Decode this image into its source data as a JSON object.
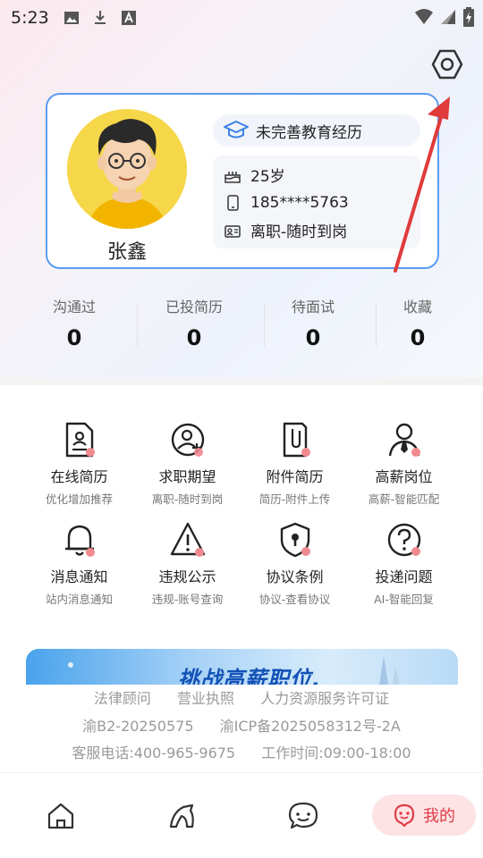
{
  "status_bar": {
    "time": "5:23"
  },
  "profile": {
    "name": "张鑫",
    "education": "未完善教育经历",
    "age": "25岁",
    "phone": "185****5763",
    "job_status": "离职-随时到岗"
  },
  "stats": [
    {
      "label": "沟通过",
      "value": "0"
    },
    {
      "label": "已投简历",
      "value": "0"
    },
    {
      "label": "待面试",
      "value": "0"
    },
    {
      "label": "收藏",
      "value": "0"
    }
  ],
  "features": [
    {
      "title": "在线简历",
      "sub": "优化增加推荐",
      "icon": "resume-icon"
    },
    {
      "title": "求职期望",
      "sub": "离职-随时到岗",
      "icon": "job-expectation-icon"
    },
    {
      "title": "附件简历",
      "sub": "简历-附件上传",
      "icon": "attachment-icon"
    },
    {
      "title": "高薪岗位",
      "sub": "高薪-智能匹配",
      "icon": "high-salary-icon"
    },
    {
      "title": "消息通知",
      "sub": "站内消息通知",
      "icon": "bell-icon"
    },
    {
      "title": "违规公示",
      "sub": "违规-账号查询",
      "icon": "warning-icon"
    },
    {
      "title": "协议条例",
      "sub": "协议-查看协议",
      "icon": "shield-lock-icon"
    },
    {
      "title": "投递问题",
      "sub": "AI-智能回复",
      "icon": "help-icon"
    }
  ],
  "banner": {
    "text": "挑战高薪职位,"
  },
  "footer": {
    "links": [
      "法律顾问",
      "营业执照",
      "人力资源服务许可证"
    ],
    "records": [
      "渝B2-20250575",
      "渝ICP备2025058312号-2A"
    ],
    "contact": [
      "客服电话:400-965-9675",
      "工作时间:09:00-18:00"
    ]
  },
  "tabbar": {
    "active_label": "我的"
  },
  "colors": {
    "accent": "#5b9cf1",
    "active_tab": "#e13b48",
    "badge_dot": "#f08a8f"
  }
}
